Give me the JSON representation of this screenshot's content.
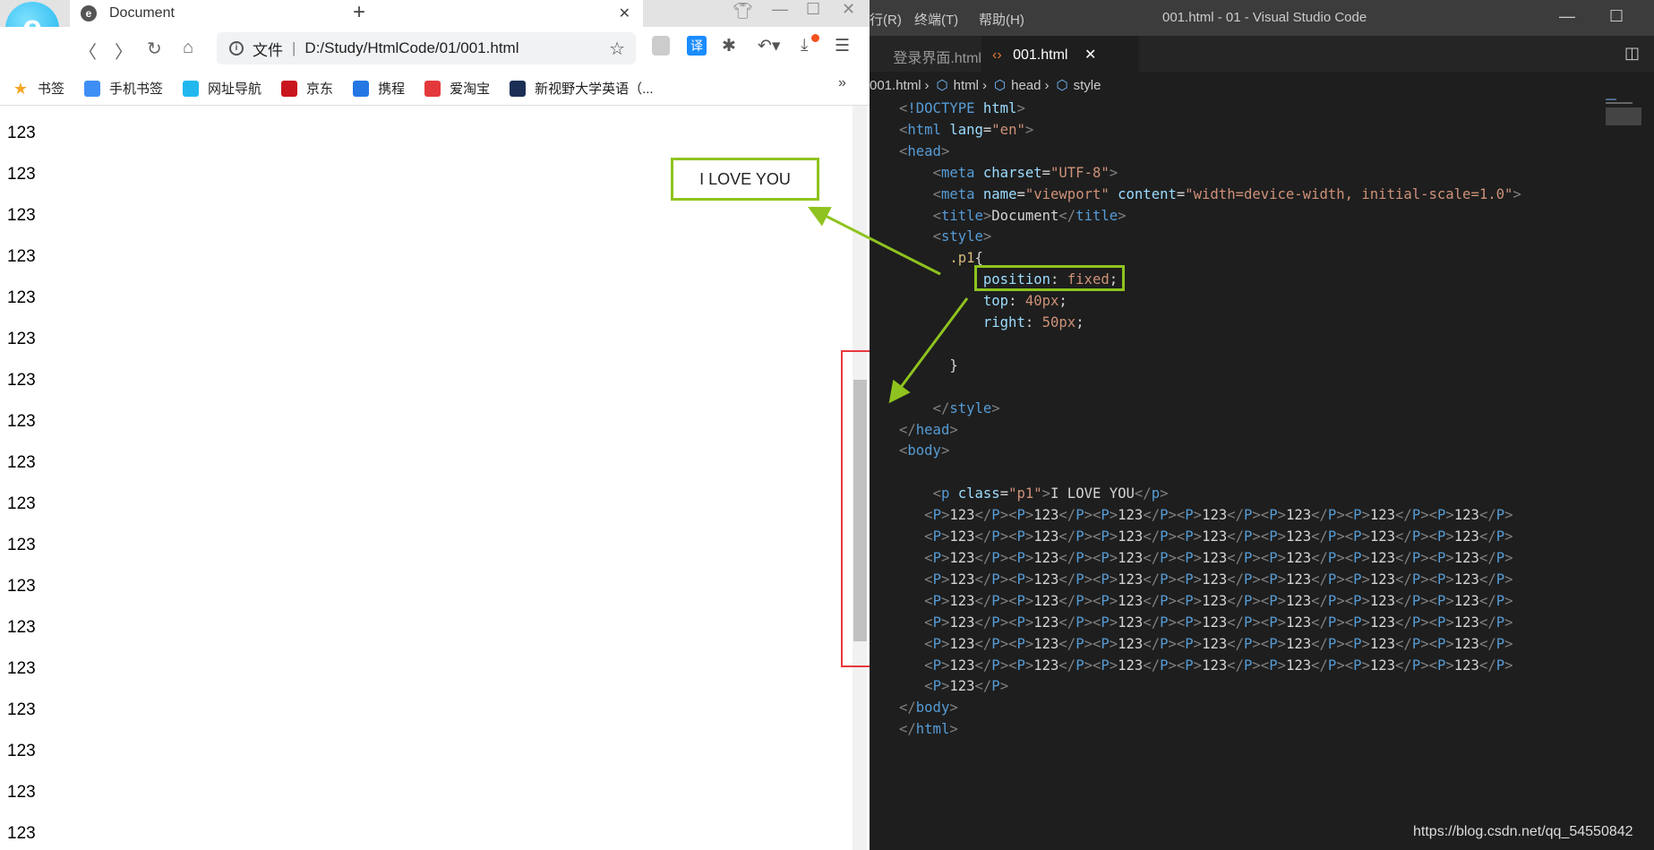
{
  "browser": {
    "tab_title": "Document",
    "address_prefix": "文件",
    "url": "D:/Study/HtmlCode/01/001.html",
    "bookmarks": [
      {
        "label": "书签",
        "icon": "star-icon",
        "color": "#f5a623"
      },
      {
        "label": "手机书签",
        "icon": "phone-icon",
        "color": "#3f8ef5"
      },
      {
        "label": "网址导航",
        "icon": "browser-e-icon",
        "color": "#22b8ee"
      },
      {
        "label": "京东",
        "icon": "jd-icon",
        "color": "#c9151e"
      },
      {
        "label": "携程",
        "icon": "ctrip-icon",
        "color": "#2577e3"
      },
      {
        "label": "爱淘宝",
        "icon": "taobao-icon",
        "color": "#e4393c"
      },
      {
        "label": "新视野大学英语（...",
        "icon": "u-icon",
        "color": "#1b2f55"
      }
    ],
    "more_label": "»",
    "paragraphs": [
      "123",
      "123",
      "123",
      "123",
      "123",
      "123",
      "123",
      "123",
      "123",
      "123",
      "123",
      "123",
      "123",
      "123",
      "123",
      "123",
      "123",
      "123"
    ],
    "fixed_text": "I LOVE YOU"
  },
  "vscode": {
    "menu": [
      "行(R)",
      "终端(T)",
      "帮助(H)"
    ],
    "title": "001.html - 01 - Visual Studio Code",
    "tabs": [
      {
        "label": "登录界面.html",
        "active": false
      },
      {
        "label": "001.html",
        "active": true
      }
    ],
    "breadcrumb": [
      "001.html",
      "html",
      "head",
      "style"
    ],
    "code_lines": [
      "<!DOCTYPE html>",
      "<html lang=\"en\">",
      "<head>",
      "    <meta charset=\"UTF-8\">",
      "    <meta name=\"viewport\" content=\"width=device-width, initial-scale=1.0\">",
      "    <title>Document</title>",
      "    <style>",
      "      .p1{",
      "          position: fixed;",
      "          top: 40px;",
      "          right: 50px;",
      "",
      "      }",
      "",
      "    </style>",
      "</head>",
      "<body>",
      "",
      "    <p class=\"p1\">I LOVE YOU</p>",
      "   <P>123</P><P>123</P><P>123</P><P>123</P><P>123</P><P>123</P><P>123</P>",
      "   <P>123</P><P>123</P><P>123</P><P>123</P><P>123</P><P>123</P><P>123</P>",
      "   <P>123</P><P>123</P><P>123</P><P>123</P><P>123</P><P>123</P><P>123</P>",
      "   <P>123</P><P>123</P><P>123</P><P>123</P><P>123</P><P>123</P><P>123</P>",
      "   <P>123</P><P>123</P><P>123</P><P>123</P><P>123</P><P>123</P><P>123</P>",
      "   <P>123</P><P>123</P><P>123</P><P>123</P><P>123</P><P>123</P><P>123</P>",
      "   <P>123</P><P>123</P><P>123</P><P>123</P><P>123</P><P>123</P><P>123</P>",
      "   <P>123</P><P>123</P><P>123</P><P>123</P><P>123</P><P>123</P><P>123</P>",
      "   <P>123</P>",
      "</body>",
      "</html>"
    ]
  },
  "watermark": "https://blog.csdn.net/qq_54550842",
  "colors": {
    "annotation_green": "#8fc31f",
    "annotation_red": "#e8383d",
    "vscode_bg": "#1e1e1e"
  }
}
